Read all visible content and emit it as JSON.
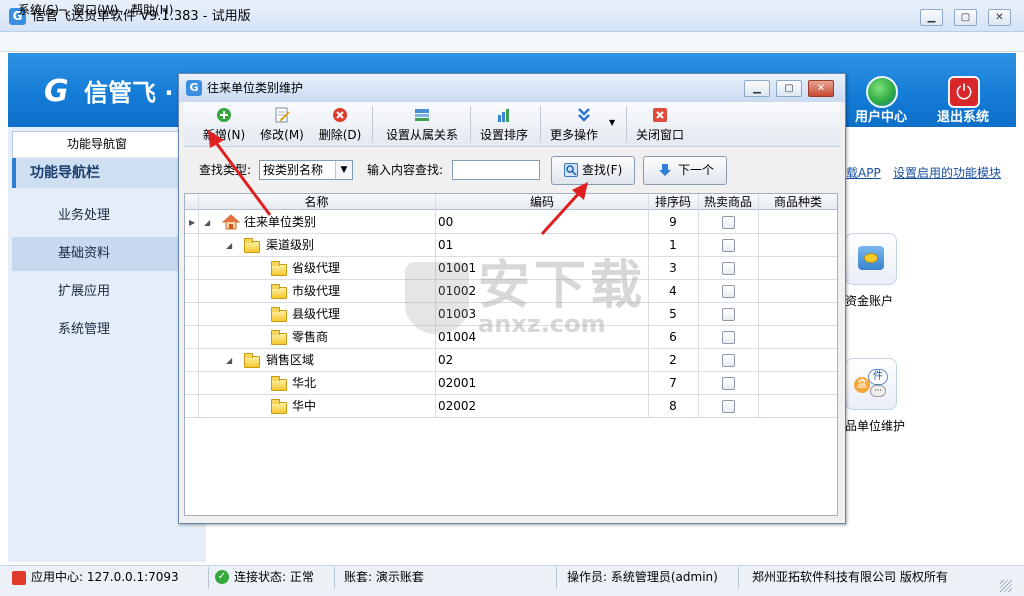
{
  "app": {
    "title": "信管飞送货单软件 V9.1.383 - 试用版",
    "icon": "app-logo-icon"
  },
  "window_buttons": [
    "minimize",
    "maximize",
    "close"
  ],
  "menubar": [
    {
      "label": "系统(S)"
    },
    {
      "label": "窗口(W)"
    },
    {
      "label": "帮助(H)"
    }
  ],
  "banner": {
    "logo_text": "信管飞 ·",
    "buttons": [
      {
        "label": "用户中心",
        "icon": "user-center-icon"
      },
      {
        "label": "退出系统",
        "icon": "power-icon"
      }
    ]
  },
  "left_nav": {
    "tab": "功能导航窗",
    "heading": "功能导航栏",
    "items": [
      {
        "label": "业务处理"
      },
      {
        "label": "基础资料",
        "active": true
      },
      {
        "label": "扩展应用"
      },
      {
        "label": "系统管理"
      }
    ]
  },
  "right_area": {
    "links": [
      "载APP",
      "设置启用的功能模块"
    ],
    "tiles": [
      {
        "label": "资金账户",
        "icon": "coins-icon"
      },
      {
        "label": "品单位维护",
        "icon": "unit-icon"
      }
    ]
  },
  "dialog": {
    "title": "往来单位类别维护",
    "toolbar": [
      {
        "label": "新增(N)",
        "icon": "add-icon"
      },
      {
        "label": "修改(M)",
        "icon": "edit-icon"
      },
      {
        "label": "删除(D)",
        "icon": "delete-icon"
      },
      {
        "label": "设置从属关系",
        "icon": "relation-icon"
      },
      {
        "label": "设置排序",
        "icon": "sort-icon"
      },
      {
        "label": "更多操作",
        "icon": "more-icon"
      },
      {
        "label": "关闭窗口",
        "icon": "close-window-icon"
      }
    ],
    "search": {
      "type_label": "查找类型:",
      "type_value": "按类别名称",
      "content_label": "输入内容查找:",
      "content_value": "",
      "find_button": "查找(F)",
      "next_button": "下一个"
    },
    "grid": {
      "columns": [
        "名称",
        "编码",
        "排序码",
        "热卖商品",
        "商品种类"
      ],
      "rows": [
        {
          "name": "往来单位类别",
          "code": "00",
          "sort": "9",
          "hot": false,
          "level": 0
        },
        {
          "name": "渠道级别",
          "code": "01",
          "sort": "1",
          "hot": false,
          "level": 1
        },
        {
          "name": "省级代理",
          "code": "01001",
          "sort": "3",
          "hot": false,
          "level": 2
        },
        {
          "name": "市级代理",
          "code": "01002",
          "sort": "4",
          "hot": false,
          "level": 2
        },
        {
          "name": "县级代理",
          "code": "01003",
          "sort": "5",
          "hot": false,
          "level": 2
        },
        {
          "name": "零售商",
          "code": "01004",
          "sort": "6",
          "hot": false,
          "level": 2
        },
        {
          "name": "销售区域",
          "code": "02",
          "sort": "2",
          "hot": false,
          "level": 1
        },
        {
          "name": "华北",
          "code": "02001",
          "sort": "7",
          "hot": false,
          "level": 2
        },
        {
          "name": "华中",
          "code": "02002",
          "sort": "8",
          "hot": false,
          "level": 2
        }
      ]
    }
  },
  "watermark": {
    "text": "安下载",
    "sub": "anxz.com"
  },
  "statusbar": {
    "app_center": "应用中心: 127.0.0.1:7093",
    "connection": "连接状态: 正常",
    "account": "账套: 演示账套",
    "operator": "操作员: 系统管理员(admin)",
    "copyright": "郑州亚拓软件科技有限公司 版权所有"
  },
  "colors": {
    "banner": "#1580d8",
    "arrow": "#e02020",
    "nav_active": "#c7d9ee"
  }
}
